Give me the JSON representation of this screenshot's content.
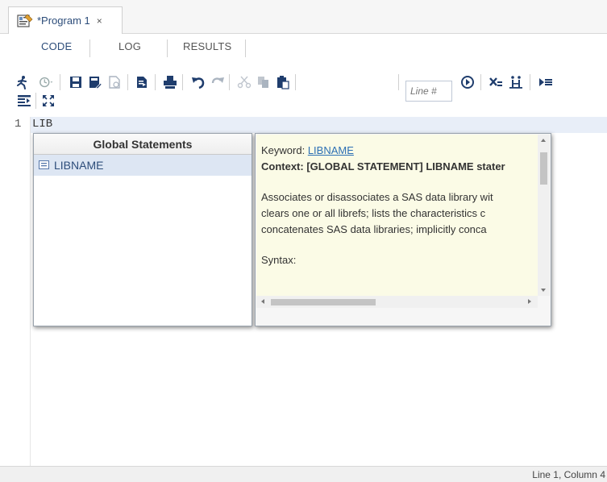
{
  "document_tab": {
    "title": "*Program 1",
    "close": "×"
  },
  "subtabs": [
    {
      "label": "CODE",
      "active": true
    },
    {
      "label": "LOG",
      "active": false
    },
    {
      "label": "RESULTS",
      "active": false
    }
  ],
  "toolbar": {
    "line_placeholder": "Line #",
    "icons": [
      "run-icon",
      "history-icon",
      "save-icon",
      "save-as-icon",
      "export-icon",
      "document-icon",
      "print-icon",
      "undo-icon",
      "redo-icon",
      "cut-icon",
      "copy-icon",
      "paste-icon",
      "goto-line-icon",
      "clear-icon",
      "program-info-icon",
      "submit-icon",
      "format-icon",
      "maximize-icon"
    ]
  },
  "editor": {
    "lines": [
      {
        "number": "1",
        "text": "LIB"
      }
    ]
  },
  "autocomplete": {
    "header": "Global Statements",
    "items": [
      {
        "label": "LIBNAME",
        "icon": "statement-icon"
      }
    ]
  },
  "help": {
    "keyword_label": "Keyword:",
    "keyword_link": "LIBNAME",
    "context": "Context: [GLOBAL STATEMENT] LIBNAME stater",
    "description_lines": [
      "Associates or disassociates a SAS data library wit",
      "clears one or all librefs; lists the characteristics c",
      "concatenates SAS data libraries; implicitly conca"
    ],
    "syntax_label": "Syntax:"
  },
  "status": {
    "position": "Line 1, Column 4"
  },
  "colors": {
    "accent": "#2d4d7a",
    "link": "#2b6fb4",
    "current_line": "#e8eef8",
    "help_bg": "#fbfbe6",
    "selected_item": "#dde6f3"
  }
}
